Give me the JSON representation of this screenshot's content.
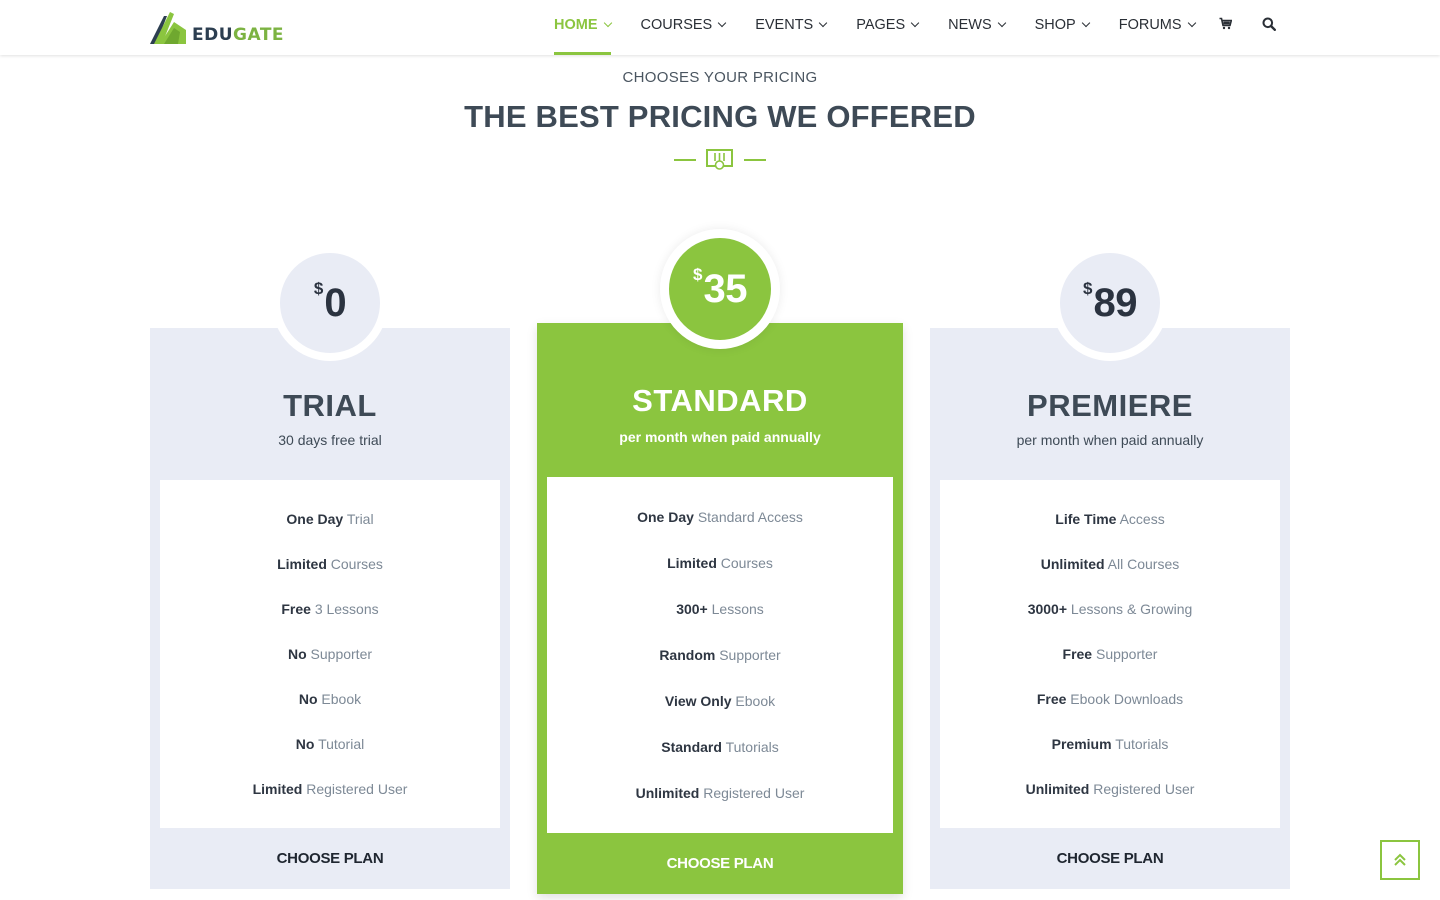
{
  "brand": {
    "part1": "EDU",
    "part2": "GATE"
  },
  "nav": {
    "items": [
      {
        "label": "HOME",
        "active": true
      },
      {
        "label": "COURSES"
      },
      {
        "label": "EVENTS"
      },
      {
        "label": "PAGES"
      },
      {
        "label": "NEWS"
      },
      {
        "label": "SHOP"
      },
      {
        "label": "FORUMS"
      }
    ],
    "icons": [
      "cart-icon",
      "search-icon"
    ]
  },
  "section": {
    "pre_title": "CHOOSES YOUR PRICING",
    "title": "THE BEST PRICING WE OFFERED"
  },
  "colors": {
    "accent": "#8bc53f",
    "card_bg": "#e9ecf5",
    "heading": "#3e4a56"
  },
  "plans": [
    {
      "currency": "$",
      "price": "0",
      "name": "TRIAL",
      "subtitle": "30 days free trial",
      "features": [
        {
          "bold": "One Day",
          "rest": "Trial"
        },
        {
          "bold": "Limited",
          "rest": "Courses"
        },
        {
          "bold": "Free",
          "rest": "3 Lessons"
        },
        {
          "bold": "No",
          "rest": "Supporter"
        },
        {
          "bold": "No",
          "rest": "Ebook"
        },
        {
          "bold": "No",
          "rest": "Tutorial"
        },
        {
          "bold": "Limited",
          "rest": "Registered User"
        }
      ],
      "cta": "CHOOSE PLAN"
    },
    {
      "currency": "$",
      "price": "35",
      "name": "STANDARD",
      "subtitle": "per month when paid annually",
      "features": [
        {
          "bold": "One Day",
          "rest": "Standard Access"
        },
        {
          "bold": "Limited",
          "rest": "Courses"
        },
        {
          "bold": "300+",
          "rest": "Lessons"
        },
        {
          "bold": "Random",
          "rest": "Supporter"
        },
        {
          "bold": "View Only",
          "rest": "Ebook"
        },
        {
          "bold": "Standard",
          "rest": "Tutorials"
        },
        {
          "bold": "Unlimited",
          "rest": "Registered User"
        }
      ],
      "cta": "CHOOSE PLAN"
    },
    {
      "currency": "$",
      "price": "89",
      "name": "PREMIERE",
      "subtitle": "per month when paid annually",
      "features": [
        {
          "bold": "Life Time",
          "rest": "Access"
        },
        {
          "bold": "Unlimited",
          "rest": "All Courses"
        },
        {
          "bold": "3000+",
          "rest": "Lessons & Growing"
        },
        {
          "bold": "Free",
          "rest": "Supporter"
        },
        {
          "bold": "Free",
          "rest": "Ebook Downloads"
        },
        {
          "bold": "Premium",
          "rest": "Tutorials"
        },
        {
          "bold": "Unlimited",
          "rest": "Registered User"
        }
      ],
      "cta": "CHOOSE PLAN"
    }
  ]
}
